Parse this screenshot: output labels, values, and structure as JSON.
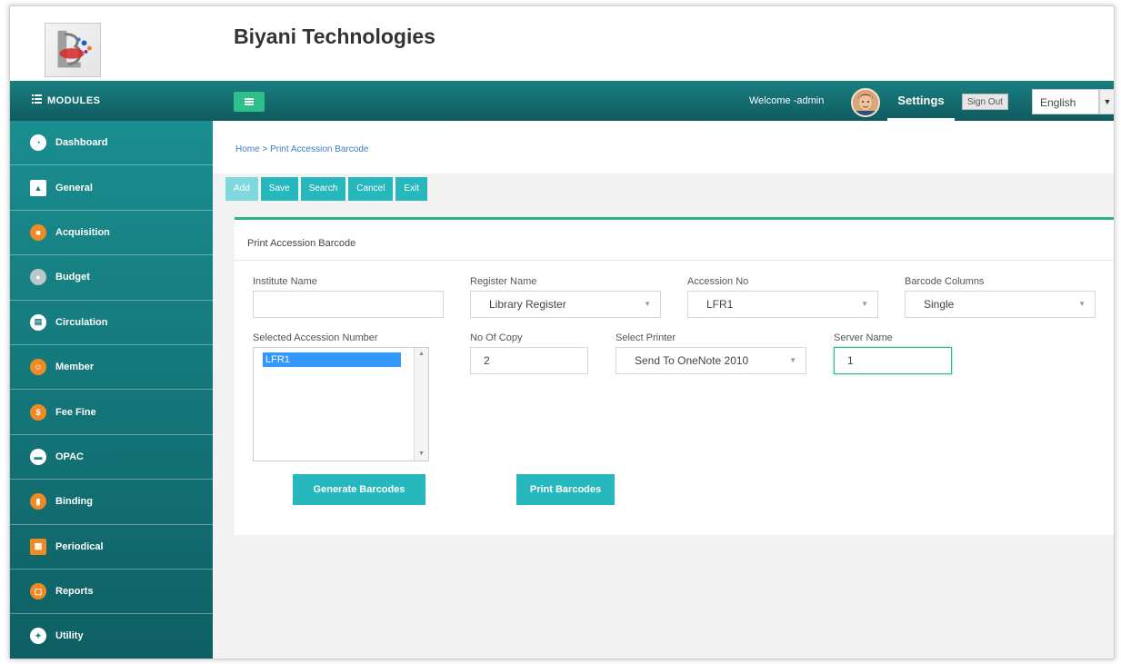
{
  "header": {
    "company_name": "Biyani Technologies"
  },
  "topbar": {
    "modules_label": "MODULES",
    "welcome_text": "Welcome -admin",
    "settings_label": "Settings",
    "signout_label": "Sign Out",
    "language_value": "English"
  },
  "sidebar": {
    "items": [
      {
        "label": "Dashboard",
        "icon": "dashboard-icon"
      },
      {
        "label": "General",
        "icon": "general-icon"
      },
      {
        "label": "Acquisition",
        "icon": "acquisition-icon"
      },
      {
        "label": "Budget",
        "icon": "budget-icon"
      },
      {
        "label": "Circulation",
        "icon": "circulation-icon"
      },
      {
        "label": "Member",
        "icon": "member-icon"
      },
      {
        "label": "Fee Fine",
        "icon": "fee-fine-icon"
      },
      {
        "label": "OPAC",
        "icon": "opac-icon"
      },
      {
        "label": "Binding",
        "icon": "binding-icon"
      },
      {
        "label": "Periodical",
        "icon": "periodical-icon"
      },
      {
        "label": "Reports",
        "icon": "reports-icon"
      },
      {
        "label": "Utility",
        "icon": "utility-icon"
      }
    ]
  },
  "breadcrumb": "Home > Print Accession Barcode",
  "toolbar": {
    "add": "Add",
    "save": "Save",
    "search": "Search",
    "cancel": "Cancel",
    "exit": "Exit"
  },
  "form": {
    "title": "Print Accession Barcode",
    "institute_name": {
      "label": "Institute Name",
      "value": ""
    },
    "register_name": {
      "label": "Register Name",
      "value": "Library Register"
    },
    "accession_no": {
      "label": "Accession No",
      "value": "LFR1"
    },
    "barcode_columns": {
      "label": "Barcode Columns",
      "value": "Single"
    },
    "selected_accession": {
      "label": "Selected Accession Number",
      "options": [
        "LFR1"
      ]
    },
    "no_of_copy": {
      "label": "No Of Copy",
      "value": "2"
    },
    "select_printer": {
      "label": "Select Printer",
      "value": "Send To OneNote 2010"
    },
    "server_name": {
      "label": "Server Name",
      "value": "1"
    },
    "generate_label": "Generate Barcodes",
    "print_label": "Print Barcodes"
  },
  "colors": {
    "teal": "#1a7f82",
    "button_teal": "#27b8bd",
    "accent_green": "#2fb28a",
    "selection_blue": "#3399ff"
  }
}
